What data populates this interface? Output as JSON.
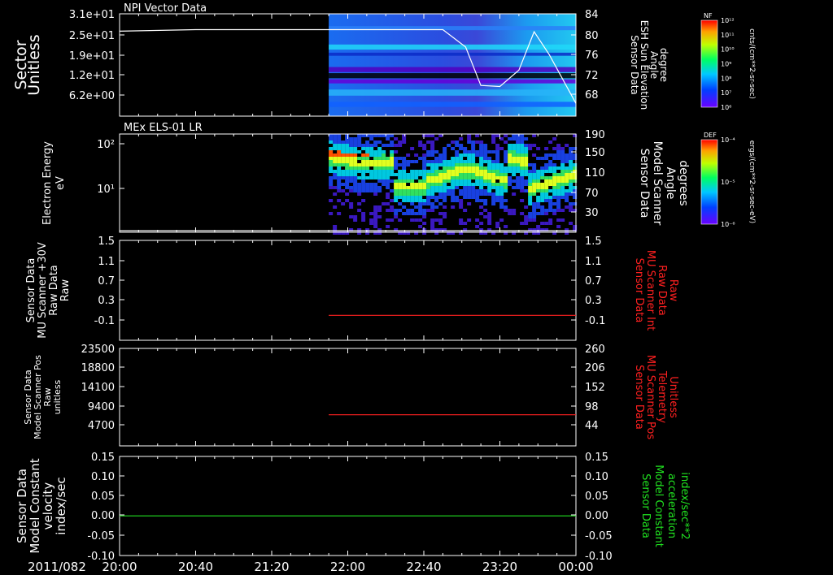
{
  "header": {
    "date": "2011/082"
  },
  "time_axis": {
    "ticks": [
      "20:00",
      "20:40",
      "21:20",
      "22:00",
      "22:40",
      "23:20",
      "00:00"
    ]
  },
  "colorbars": [
    {
      "label": "NF",
      "title": "cnts/(cm**2-sr-sec)",
      "ticks": [
        "10¹²",
        "10¹¹",
        "10¹⁰",
        "10⁹",
        "10⁸",
        "10⁷",
        "10⁶"
      ]
    },
    {
      "label": "DEF",
      "title": "ergs/(cm**2-sr-sec-eV)",
      "ticks": [
        "10⁻⁴",
        "10⁻⁵",
        "10⁻⁶"
      ]
    }
  ],
  "colors": {
    "white": "#ffffff",
    "red": "#ff2020",
    "green": "#20e020",
    "frame": "#ffffff"
  },
  "chart_data": [
    {
      "type": "heatmap",
      "title": "NPI Vector Data",
      "ylabel": [
        "Sector",
        "Unitless"
      ],
      "yticks": [
        "3.1e+01",
        "2.5e+01",
        "1.9e+01",
        "1.2e+01",
        "6.2e+00"
      ],
      "right_label": [
        "Sensor Data",
        "ESH Sun Elevation",
        "Angle",
        "degree"
      ],
      "right_ticks": [
        "84",
        "80",
        "76",
        "72",
        "68"
      ],
      "ylim_right": [
        64,
        84
      ],
      "data_start": "21:50",
      "series": [
        {
          "name": "ESH Sun Elevation Angle",
          "color": "white",
          "x": [
            "20:00",
            "20:40",
            "21:50",
            "22:50",
            "23:02",
            "23:10",
            "23:20",
            "23:30",
            "23:38",
            "23:46",
            "24:00"
          ],
          "y": [
            80.6,
            80.9,
            80.9,
            80.9,
            77.5,
            70.0,
            69.8,
            73.0,
            80.5,
            76.0,
            66.5
          ]
        }
      ]
    },
    {
      "type": "heatmap",
      "title": "MEx ELS-01 LR",
      "ylabel": [
        "Electron Energy",
        "eV"
      ],
      "yticks": [
        "10²",
        "10¹"
      ],
      "right_label": [
        "Sensor Data",
        "Model Scanner",
        "Angle",
        "degrees"
      ],
      "right_ticks": [
        "190",
        "150",
        "110",
        "70",
        "30"
      ],
      "ylim_right": [
        0,
        190
      ],
      "data_start": "21:50",
      "series": [
        {
          "name": "Model Scanner Angle",
          "color": "white",
          "x": [
            "20:00",
            "24:00"
          ],
          "y": [
            3,
            3
          ]
        }
      ]
    },
    {
      "type": "line",
      "ylabel": [
        "Sensor Data",
        "MU Scanner +30V",
        "Raw Data",
        "Raw"
      ],
      "yticks": [
        "1.5",
        "1.1",
        "0.7",
        "0.3",
        "-0.1"
      ],
      "ylim": [
        -0.5,
        1.5
      ],
      "right_label": [
        "Sensor Data",
        "MU Scanner Int",
        "Raw Data",
        "Raw"
      ],
      "right_ticks": [
        "1.5",
        "1.1",
        "0.7",
        "0.3",
        "-0.1"
      ],
      "ylim_right": [
        -0.5,
        1.5
      ],
      "series": [
        {
          "name": "MU Scanner Int Raw Data",
          "color": "red",
          "x": [
            "21:50",
            "24:00"
          ],
          "y": [
            0.0,
            0.0
          ]
        }
      ]
    },
    {
      "type": "line",
      "ylabel": [
        "Sensor Data",
        "Model Scanner Pos",
        "Raw",
        "unitless"
      ],
      "yticks": [
        "23500",
        "18800",
        "14100",
        "9400",
        "4700"
      ],
      "ylim": [
        0,
        23500
      ],
      "right_label": [
        "Sensor Data",
        "MU Scanner Pos",
        "Telemetry",
        "Unitless"
      ],
      "right_ticks": [
        "260",
        "206",
        "152",
        "98",
        "44"
      ],
      "ylim_right": [
        0,
        260
      ],
      "series": [
        {
          "name": "MU Scanner Pos Telemetry",
          "color": "red",
          "x": [
            "21:50",
            "24:00"
          ],
          "y": [
            83,
            83
          ]
        }
      ]
    },
    {
      "type": "line",
      "ylabel": [
        "Sensor Data",
        "Model Constant",
        "velocity",
        "index/sec"
      ],
      "yticks": [
        "0.15",
        "0.10",
        "0.05",
        "0.00",
        "-0.05",
        "-0.10"
      ],
      "ylim": [
        -0.1,
        0.15
      ],
      "right_label": [
        "Sensor Data",
        "Model Constant",
        "acceleration",
        "index/sec**2"
      ],
      "right_ticks": [
        "0.15",
        "0.10",
        "0.05",
        "0.00",
        "-0.05",
        "-0.10"
      ],
      "ylim_right": [
        -0.1,
        0.15
      ],
      "series": [
        {
          "name": "Model Constant velocity",
          "color": "green",
          "x": [
            "20:00",
            "24:00"
          ],
          "y": [
            0.0,
            0.0
          ]
        }
      ]
    }
  ]
}
